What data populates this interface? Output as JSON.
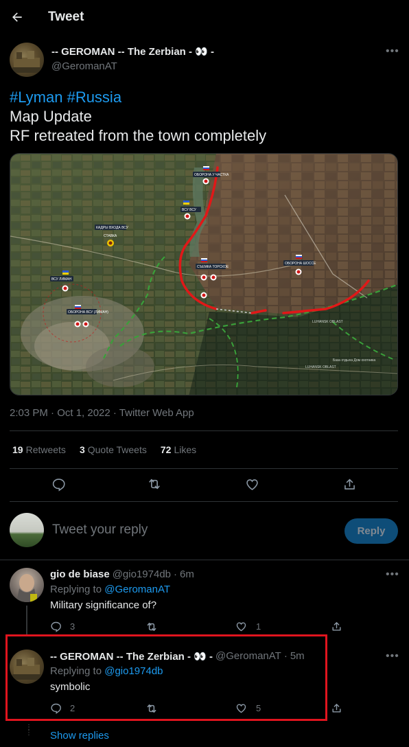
{
  "header": {
    "title": "Tweet",
    "back_icon": "arrow-left-icon"
  },
  "tweet": {
    "author_name": "-- GEROMAN -- The Zerbian -",
    "author_emoji": "👀",
    "author_suffix": "-",
    "author_handle": "@GeromanAT",
    "hashtag_1": "#Lyman",
    "hashtag_2": "#Russia",
    "line_2": "Map Update",
    "line_3": "RF retreated from the town completely",
    "meta": "2:03 PM · Oct 1, 2022 · Twitter Web App",
    "stats": {
      "retweets_count": "19",
      "retweets_label": "Retweets",
      "quotes_count": "3",
      "quotes_label": "Quote Tweets",
      "likes_count": "72",
      "likes_label": "Likes"
    }
  },
  "map": {
    "labels": {
      "defense_north": "ОБОРОНА У ЧАСТКА",
      "exit_point": "КАДРЫ ВХОДА ВСУ",
      "stavka": "СТАВКА",
      "vsu_armed": "ВСУ ВСУ",
      "defense_vsu": "ОБОРОНА ВСУ (ЛИМАН)",
      "camera": "СЪЕМКА ТОРСКОЕ",
      "defense_highway": "ОБОРОНА ШОССЕ",
      "vsu_lyman": "ВСУ ЛИМАН",
      "luhansk_1": "LUHANSK OBLAST",
      "luhansk_2": "LUHANSK OBLAST",
      "dacha": "База отдыха Дом охотника"
    }
  },
  "compose": {
    "placeholder": "Tweet your reply",
    "button": "Reply"
  },
  "replies": [
    {
      "name": "gio de biase",
      "handle": "@gio1974db",
      "sep": "·",
      "time": "6m",
      "replying_prefix": "Replying to",
      "replying_to": "@GeromanAT",
      "text": "Military significance of?",
      "reply_count": "3",
      "like_count": "1"
    },
    {
      "name": "-- GEROMAN -- The Zerbian - 👀 -",
      "handle": "@GeromanAT",
      "sep": "·",
      "time": "5m",
      "replying_prefix": "Replying to",
      "replying_to": "@gio1974db",
      "text": "symbolic",
      "reply_count": "2",
      "like_count": "5"
    }
  ],
  "show_replies": "Show replies",
  "colors": {
    "accent": "#1d9bf0",
    "highlight": "#e0141e",
    "background": "#000000",
    "frontline": "#e01818",
    "border_line": "#3aa03a"
  }
}
